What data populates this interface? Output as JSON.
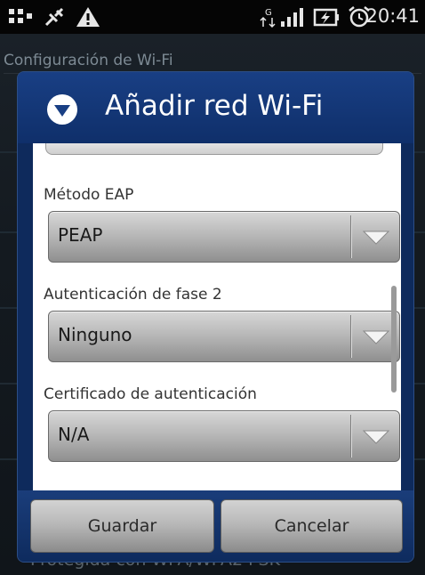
{
  "status_bar": {
    "time": "20:41",
    "left_icons": [
      "usb-debug-icon",
      "satellite-icon",
      "warning-icon"
    ],
    "right_icons": [
      "data-transfer-icon",
      "signal-icon",
      "battery-charging-icon",
      "alarm-icon"
    ]
  },
  "background_screen": {
    "title": "Configuración de Wi-Fi",
    "footer_text": "Protegida con WPA/WPA2 PSK"
  },
  "dialog": {
    "title": "Añadir red Wi-Fi",
    "fields": [
      {
        "label": "Método EAP",
        "value": "PEAP"
      },
      {
        "label": "Autenticación de fase 2",
        "value": "Ninguno"
      },
      {
        "label": "Certificado de autenticación",
        "value": "N/A"
      }
    ],
    "buttons": {
      "save_label": "Guardar",
      "cancel_label": "Cancelar"
    }
  },
  "colors": {
    "dialog_header": "#193f84",
    "dialog_frame": "#0e2a5c",
    "body": "#ffffff"
  }
}
